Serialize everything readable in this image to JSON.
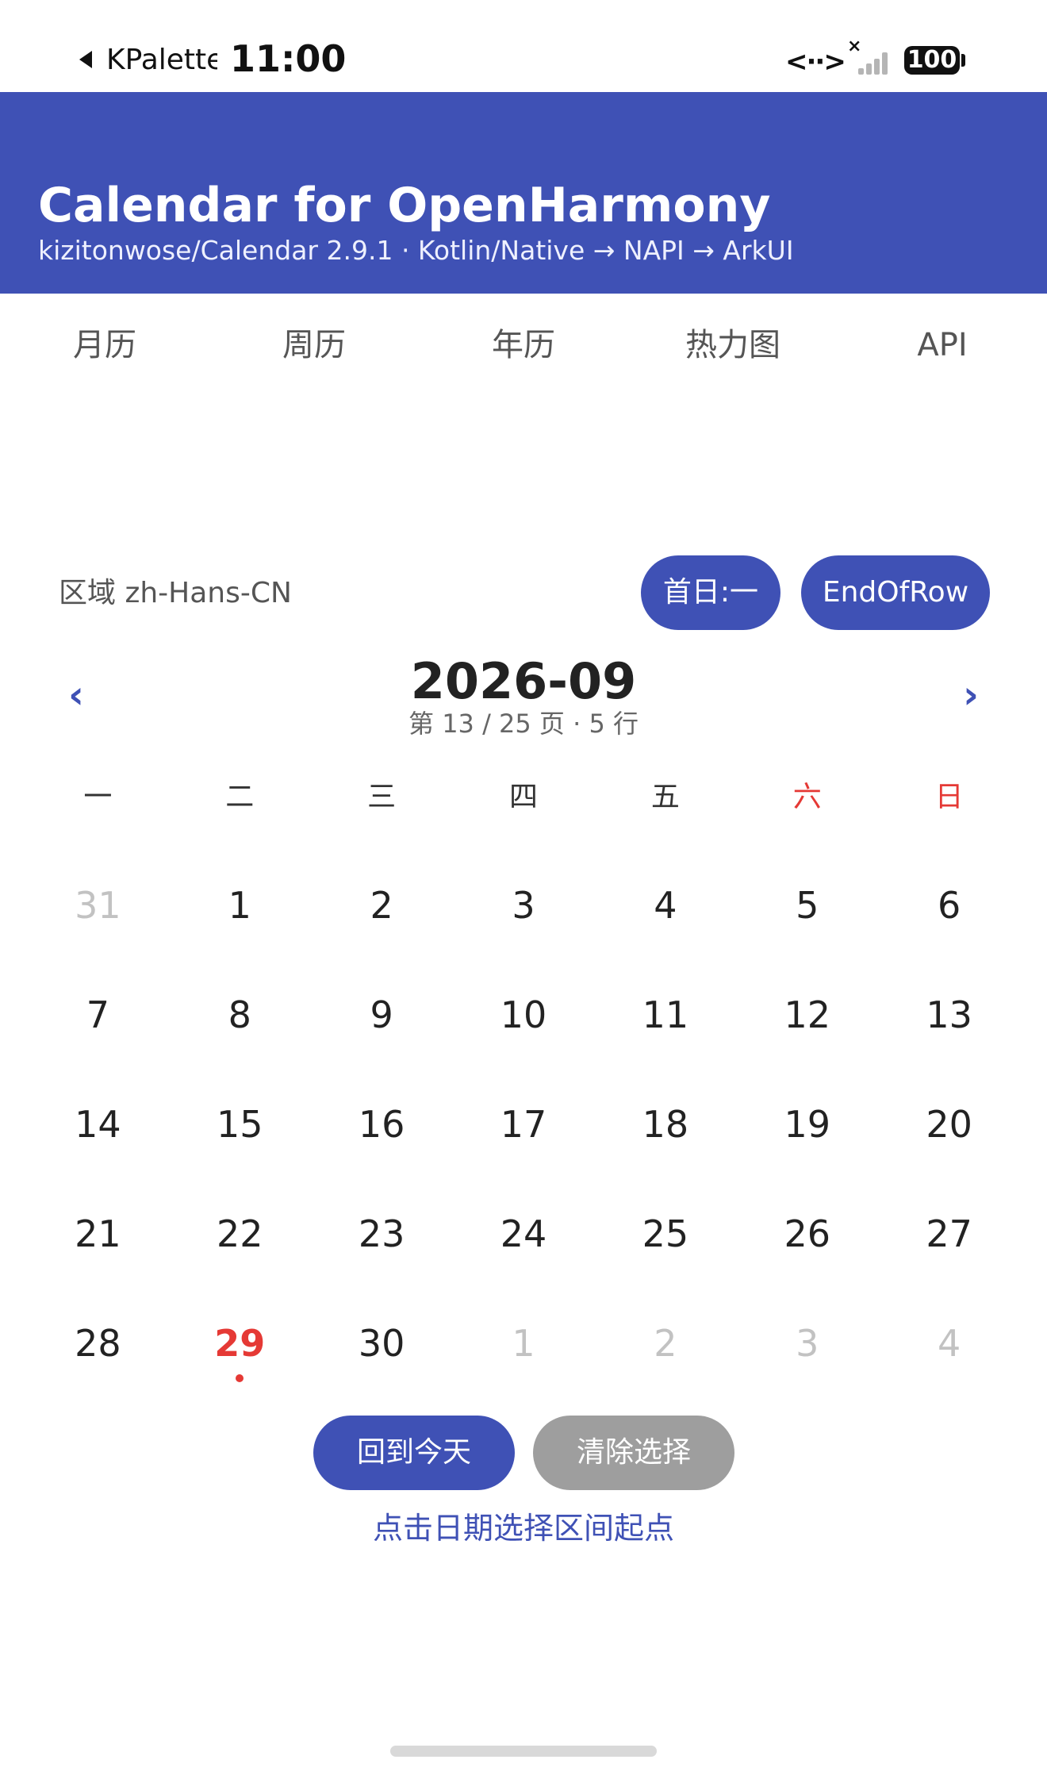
{
  "status_bar": {
    "app_name": "KPalette",
    "time": "11:00",
    "network": "<··>",
    "battery": "100"
  },
  "header": {
    "title": "Calendar for OpenHarmony",
    "subtitle": "kizitonwose/Calendar 2.9.1 · Kotlin/Native → NAPI → ArkUI",
    "background": "#3f51b5"
  },
  "tabs": [
    {
      "label": "月历",
      "active": true
    },
    {
      "label": "周历",
      "active": false
    },
    {
      "label": "年历",
      "active": false
    },
    {
      "label": "热力图",
      "active": false
    },
    {
      "label": "API",
      "active": false
    }
  ],
  "locale": {
    "label": "区域 zh-Hans-CN",
    "first_day_button": "首日:一",
    "end_of_row_button": "EndOfRow"
  },
  "month": {
    "title": "2026-09",
    "subtitle": "第 13 / 25 页 · 5 行",
    "prev_icon": "‹",
    "next_icon": "›"
  },
  "weekdays": [
    {
      "label": "一",
      "weekend": false
    },
    {
      "label": "二",
      "weekend": false
    },
    {
      "label": "三",
      "weekend": false
    },
    {
      "label": "四",
      "weekend": false
    },
    {
      "label": "五",
      "weekend": false
    },
    {
      "label": "六",
      "weekend": true
    },
    {
      "label": "日",
      "weekend": true
    }
  ],
  "weeks": [
    [
      {
        "day": "31",
        "state": "muted"
      },
      {
        "day": "1",
        "state": "normal"
      },
      {
        "day": "2",
        "state": "normal"
      },
      {
        "day": "3",
        "state": "normal"
      },
      {
        "day": "4",
        "state": "normal"
      },
      {
        "day": "5",
        "state": "normal"
      },
      {
        "day": "6",
        "state": "normal"
      }
    ],
    [
      {
        "day": "7",
        "state": "normal"
      },
      {
        "day": "8",
        "state": "normal"
      },
      {
        "day": "9",
        "state": "normal"
      },
      {
        "day": "10",
        "state": "normal"
      },
      {
        "day": "11",
        "state": "normal"
      },
      {
        "day": "12",
        "state": "normal"
      },
      {
        "day": "13",
        "state": "normal"
      }
    ],
    [
      {
        "day": "14",
        "state": "normal"
      },
      {
        "day": "15",
        "state": "normal"
      },
      {
        "day": "16",
        "state": "normal"
      },
      {
        "day": "17",
        "state": "normal"
      },
      {
        "day": "18",
        "state": "normal"
      },
      {
        "day": "19",
        "state": "normal"
      },
      {
        "day": "20",
        "state": "normal"
      }
    ],
    [
      {
        "day": "21",
        "state": "normal"
      },
      {
        "day": "22",
        "state": "normal"
      },
      {
        "day": "23",
        "state": "normal"
      },
      {
        "day": "24",
        "state": "normal"
      },
      {
        "day": "25",
        "state": "normal"
      },
      {
        "day": "26",
        "state": "normal"
      },
      {
        "day": "27",
        "state": "normal"
      }
    ],
    [
      {
        "day": "28",
        "state": "normal"
      },
      {
        "day": "29",
        "state": "today"
      },
      {
        "day": "30",
        "state": "normal"
      },
      {
        "day": "1",
        "state": "muted"
      },
      {
        "day": "2",
        "state": "muted"
      },
      {
        "day": "3",
        "state": "muted"
      },
      {
        "day": "4",
        "state": "muted"
      }
    ]
  ],
  "actions": {
    "today_button": "回到今天",
    "clear_button": "清除选择",
    "hint": "点击日期选择区间起点"
  },
  "colors": {
    "accent": "#3f51b5",
    "today": "#e53935",
    "weekend": "#e53935",
    "muted_day": "#c2c2c2",
    "clear_button": "#9e9e9e"
  }
}
